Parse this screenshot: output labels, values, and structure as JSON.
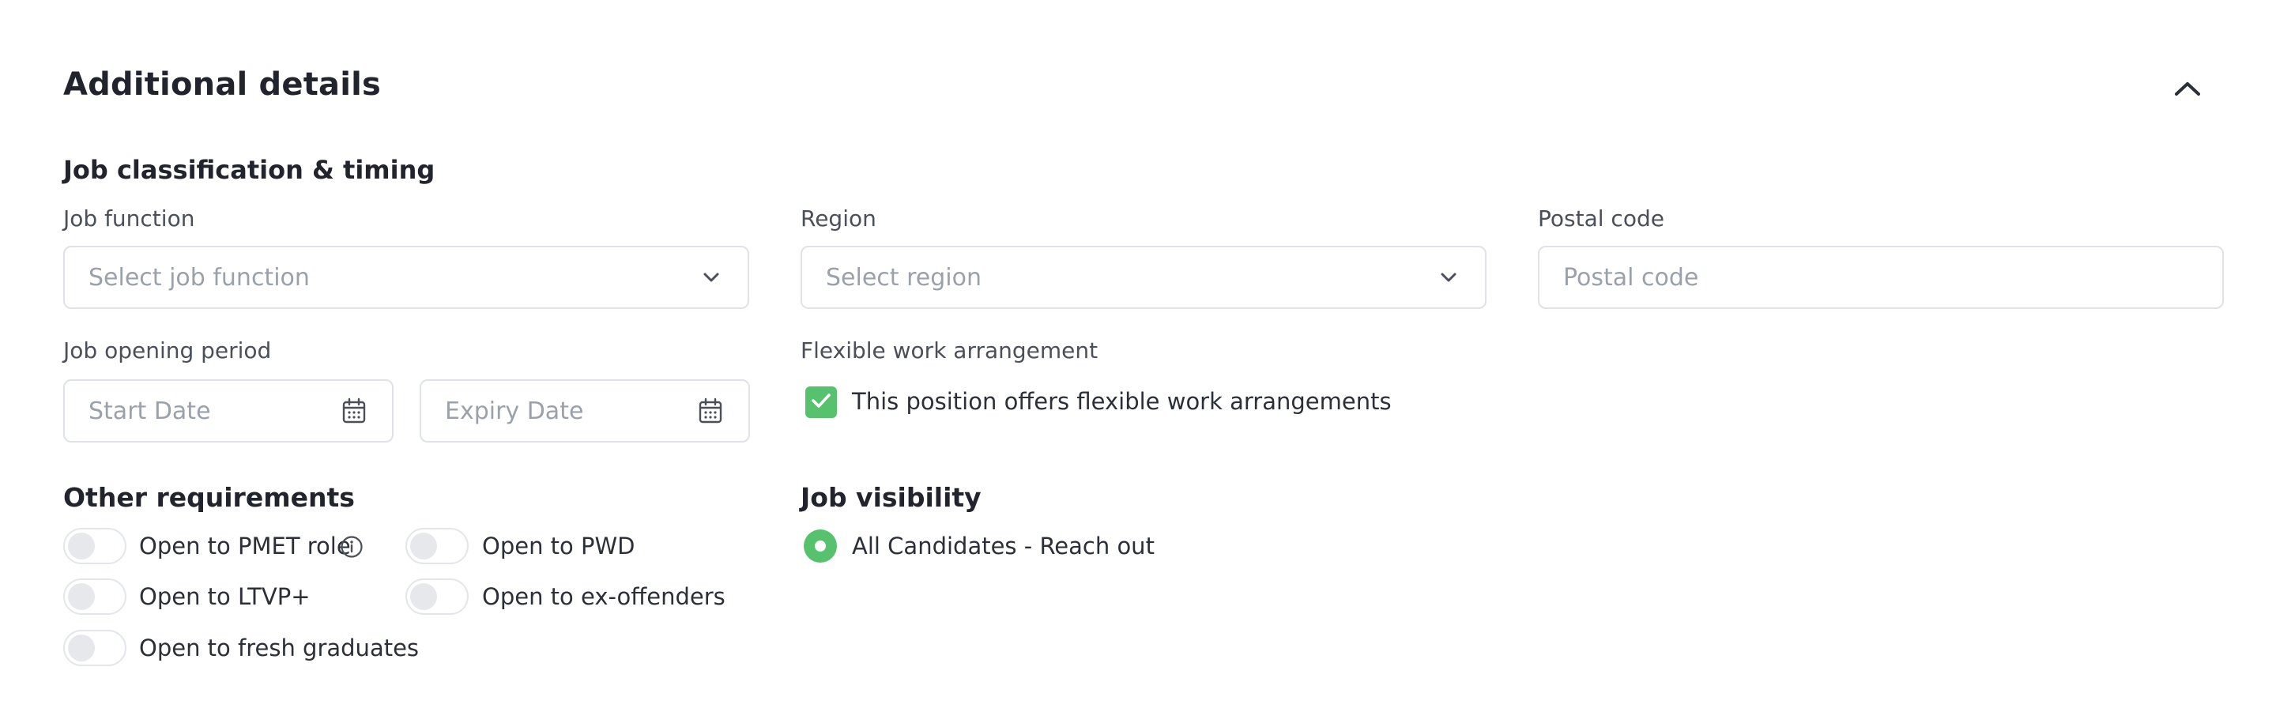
{
  "section": {
    "title": "Additional details",
    "collapse_icon": "chevron-up-icon"
  },
  "classification": {
    "title": "Job classification & timing",
    "job_function": {
      "label": "Job function",
      "placeholder": "Select job function"
    },
    "region": {
      "label": "Region",
      "placeholder": "Select region"
    },
    "postal_code": {
      "label": "Postal code",
      "placeholder": "Postal code"
    },
    "opening_period": {
      "label": "Job opening period",
      "start_placeholder": "Start Date",
      "expiry_placeholder": "Expiry Date"
    },
    "flexible": {
      "label": "Flexible work arrangement",
      "checkbox_label": "This position offers flexible work arrangements",
      "checked": true
    }
  },
  "requirements": {
    "title": "Other requirements",
    "toggles": [
      {
        "label": "Open to PMET role",
        "on": false,
        "has_info": true
      },
      {
        "label": "Open to PWD",
        "on": false
      },
      {
        "label": "Open to LTVP+",
        "on": false
      },
      {
        "label": "Open to ex-offenders",
        "on": false
      },
      {
        "label": "Open to fresh graduates",
        "on": false
      }
    ]
  },
  "visibility": {
    "title": "Job visibility",
    "option_label": "All Candidates - Reach out",
    "selected": true
  },
  "colors": {
    "accent_green": "#56c26e",
    "border": "#dfe2e7",
    "placeholder": "#9aa1ab"
  }
}
